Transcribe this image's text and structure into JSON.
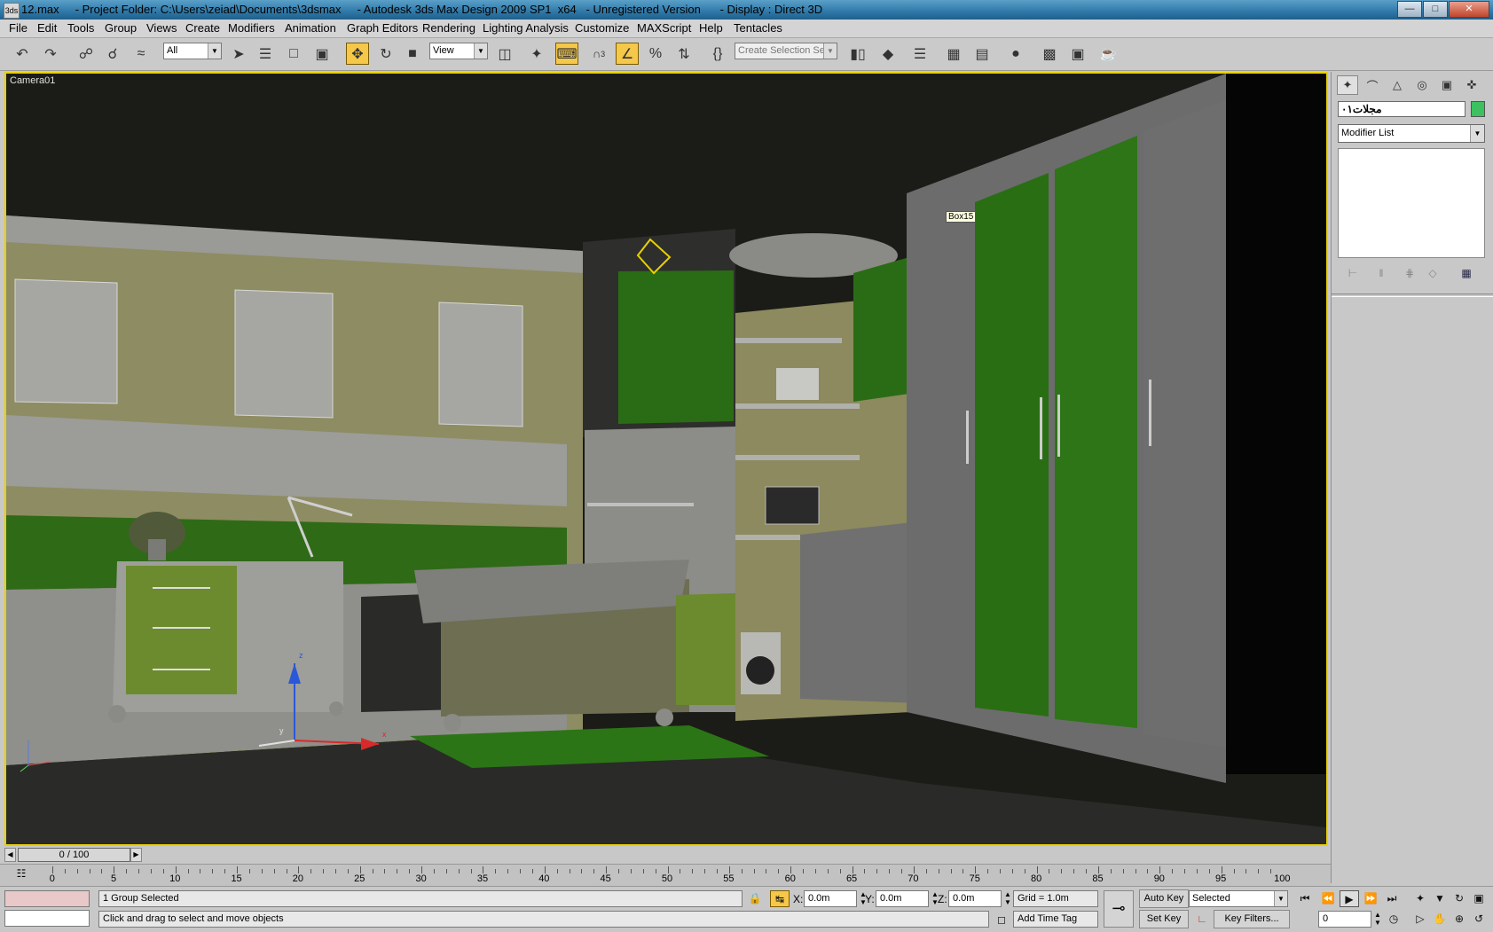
{
  "window": {
    "app_icon": "3ds",
    "title": "12.max     - Project Folder: C:\\Users\\zeiad\\Documents\\3dsmax     - Autodesk 3ds Max Design 2009 SP1  x64   - Unregistered Version      - Display : Direct 3D",
    "controls": [
      "minimize-icon",
      "maximize-icon",
      "close-icon"
    ]
  },
  "menu": [
    "File",
    "Edit",
    "Tools",
    "Group",
    "Views",
    "Create",
    "Modifiers",
    "Animation",
    "Graph Editors",
    "Rendering",
    "Lighting Analysis",
    "Customize",
    "MAXScript",
    "Help",
    "Tentacles"
  ],
  "toolbar": {
    "selection_filter": "All",
    "reference_coord": "View",
    "named_selection_placeholder": "Create Selection Set",
    "snap_label": "3",
    "icons": [
      "undo-icon",
      "redo-icon",
      "select-link-icon",
      "unlink-icon",
      "bind-space-warp-icon",
      "select-object-icon",
      "select-by-name-icon",
      "rect-selection-icon",
      "window-crossing-icon",
      "move-icon",
      "rotate-icon",
      "scale-icon",
      "pivot-icon",
      "manipulate-icon",
      "keyboard-shortcut-icon",
      "snap-icon",
      "angle-snap-icon",
      "percent-snap-icon",
      "spinner-snap-icon",
      "edit-named-selection-icon",
      "mirror-icon",
      "align-icon",
      "layer-manager-icon",
      "curve-editor-icon",
      "schematic-view-icon",
      "material-editor-icon",
      "render-setup-icon",
      "rendered-frame-icon",
      "render-teapot-icon"
    ]
  },
  "viewport": {
    "label": "Camera01",
    "tooltip": "Box15",
    "axis_labels": {
      "x": "x",
      "y": "y",
      "z": "z"
    }
  },
  "command_panel": {
    "tabs": [
      "create-tab-icon",
      "modify-tab-icon",
      "hierarchy-tab-icon",
      "motion-tab-icon",
      "display-tab-icon",
      "utilities-tab-icon"
    ],
    "object_name": "مجلات٠١",
    "object_color": "#3cc060",
    "modifier_list": "Modifier List"
  },
  "timeslider": {
    "position": "0 / 100",
    "ticks": [
      "0",
      "5",
      "10",
      "15",
      "20",
      "25",
      "30",
      "35",
      "40",
      "45",
      "50",
      "55",
      "60",
      "65",
      "70",
      "75",
      "80",
      "85",
      "90",
      "95",
      "100"
    ]
  },
  "status": {
    "selection_count": "1 Group Selected",
    "prompt": "Click and drag to select and move objects",
    "x_label": "X:",
    "y_label": "Y:",
    "z_label": "Z:",
    "x_value": "0.0m",
    "y_value": "0.0m",
    "z_value": "0.0m",
    "grid": "Grid = 1.0m",
    "add_time_tag": "Add Time Tag",
    "auto_key": "Auto Key",
    "set_key": "Set Key",
    "key_mode": "Selected",
    "key_filters": "Key Filters...",
    "current_frame": "0"
  }
}
